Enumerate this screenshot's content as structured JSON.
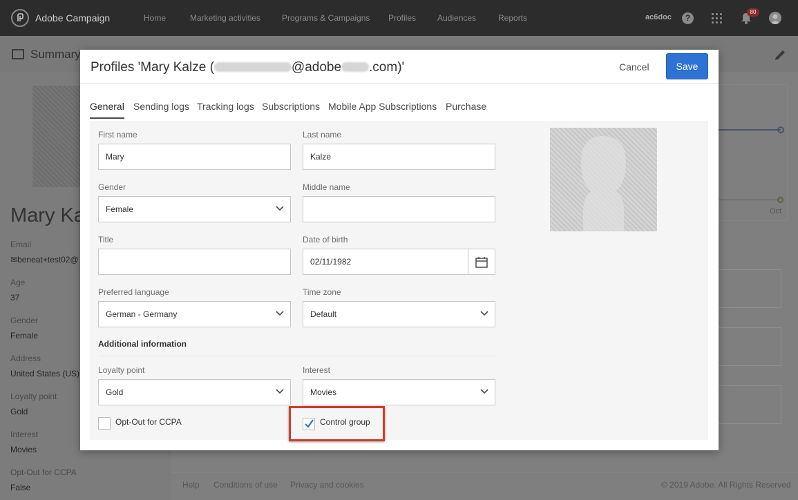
{
  "topbar": {
    "brand": "Adobe Campaign",
    "nav": [
      "Home",
      "Marketing activities",
      "Programs & Campaigns",
      "Profiles",
      "Audiences",
      "Reports"
    ],
    "org": "ac6doc",
    "notification_count": "80",
    "icons": [
      "adobe-campaign-logo-icon",
      "help-icon",
      "apps-grid-icon",
      "bell-icon",
      "user-avatar-icon"
    ]
  },
  "background_page": {
    "title": "Summary",
    "name": "Mary Ka",
    "fields": [
      {
        "label": "Email",
        "value": "beneat+test02@"
      },
      {
        "label": "Age",
        "value": "37"
      },
      {
        "label": "Gender",
        "value": "Female"
      },
      {
        "label": "Address",
        "value": "United States (US)"
      },
      {
        "label": "Loyalty point",
        "value": "Gold"
      },
      {
        "label": "Interest",
        "value": "Movies"
      },
      {
        "label": "Opt-Out for CCPA",
        "value": "False"
      }
    ],
    "chart_tick": "Oct",
    "footer": {
      "links": [
        "Help",
        "Conditions of use",
        "Privacy and cookies"
      ],
      "copyright": "© 2019 Adobe. All Rights Reserved"
    }
  },
  "modal": {
    "title_prefix": "Profiles 'Mary Kalze (",
    "title_mid": "@adobe",
    "title_suffix": ".com)'",
    "cancel_label": "Cancel",
    "save_label": "Save",
    "tabs": [
      "General",
      "Sending logs",
      "Tracking logs",
      "Subscriptions",
      "Mobile App Subscriptions",
      "Purchase"
    ],
    "active_tab": "General",
    "form": {
      "first_name": {
        "label": "First name",
        "value": "Mary"
      },
      "last_name": {
        "label": "Last name",
        "value": "Kalze"
      },
      "gender": {
        "label": "Gender",
        "value": "Female"
      },
      "middle_name": {
        "label": "Middle name",
        "value": ""
      },
      "title": {
        "label": "Title",
        "value": ""
      },
      "date_of_birth": {
        "label": "Date of birth",
        "value": "02/11/1982"
      },
      "preferred_language": {
        "label": "Preferred language",
        "value": "German - Germany"
      },
      "time_zone": {
        "label": "Time zone",
        "value": "Default"
      },
      "additional_info_title": "Additional information",
      "loyalty_point": {
        "label": "Loyalty point",
        "value": "Gold"
      },
      "interest": {
        "label": "Interest",
        "value": "Movies"
      },
      "opt_out_ccpa": {
        "label": "Opt-Out for CCPA",
        "checked": false
      },
      "control_group": {
        "label": "Control group",
        "checked": true
      }
    },
    "colors": {
      "primary": "#2d73d4",
      "highlight": "#d33a2c",
      "check": "#2d73d4"
    }
  }
}
